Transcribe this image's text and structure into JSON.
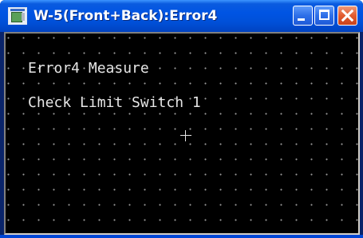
{
  "window": {
    "title": "W-5(Front+Back):Error4",
    "icon": "display-app-icon",
    "controls": {
      "minimize": "minimize-icon",
      "maximize": "maximize-icon",
      "close": "close-icon"
    }
  },
  "screen": {
    "line1": "Error4 Measure",
    "line2": "Check Limit Switch 1",
    "cursor_icon": "crosshair-icon"
  },
  "colors": {
    "titlebar": "#0054e3",
    "close_button": "#e25b2f",
    "screen_background": "#000000",
    "screen_text": "#e6e6e6",
    "grid_dots": "#9a9a9a"
  }
}
